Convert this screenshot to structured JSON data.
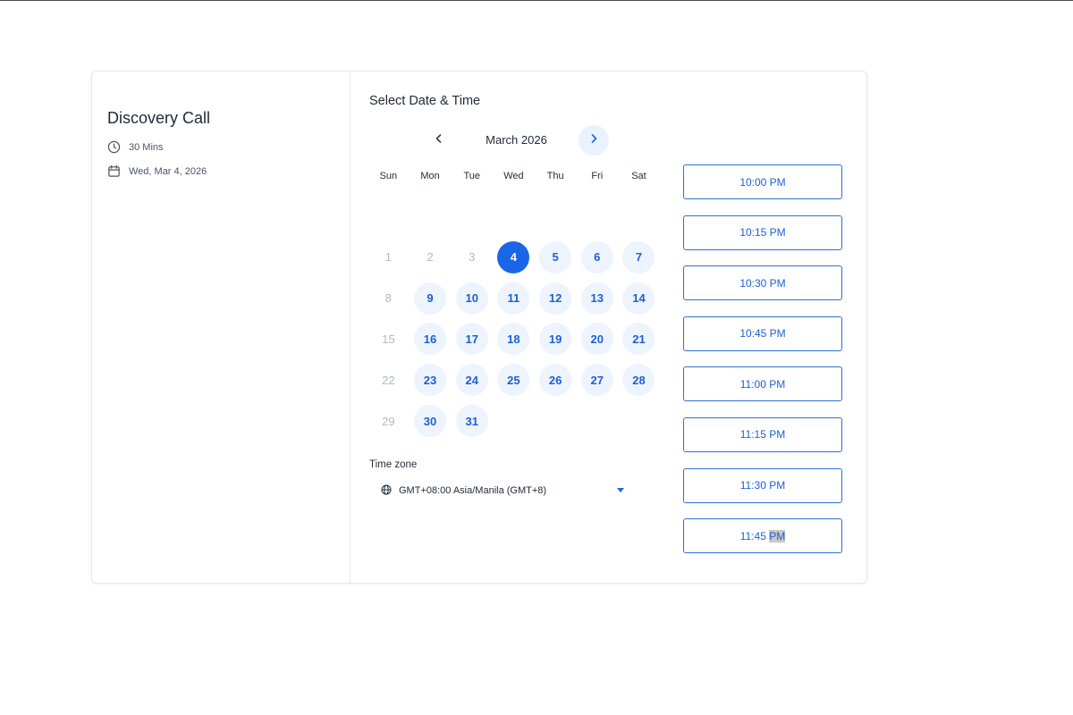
{
  "event": {
    "title": "Discovery Call",
    "duration": "30 Mins",
    "date": "Wed, Mar 4, 2026"
  },
  "picker": {
    "title": "Select Date & Time",
    "month": "March 2026",
    "weekdays": [
      "Sun",
      "Mon",
      "Tue",
      "Wed",
      "Thu",
      "Fri",
      "Sat"
    ],
    "first_weekday_offset": 0,
    "days": [
      {
        "d": "1",
        "state": "disabled"
      },
      {
        "d": "2",
        "state": "disabled"
      },
      {
        "d": "3",
        "state": "disabled"
      },
      {
        "d": "4",
        "state": "selected"
      },
      {
        "d": "5",
        "state": "available"
      },
      {
        "d": "6",
        "state": "available"
      },
      {
        "d": "7",
        "state": "available"
      },
      {
        "d": "8",
        "state": "disabled"
      },
      {
        "d": "9",
        "state": "available"
      },
      {
        "d": "10",
        "state": "available"
      },
      {
        "d": "11",
        "state": "available"
      },
      {
        "d": "12",
        "state": "available"
      },
      {
        "d": "13",
        "state": "available"
      },
      {
        "d": "14",
        "state": "available"
      },
      {
        "d": "15",
        "state": "disabled"
      },
      {
        "d": "16",
        "state": "available"
      },
      {
        "d": "17",
        "state": "available"
      },
      {
        "d": "18",
        "state": "available"
      },
      {
        "d": "19",
        "state": "available"
      },
      {
        "d": "20",
        "state": "available"
      },
      {
        "d": "21",
        "state": "available"
      },
      {
        "d": "22",
        "state": "disabled"
      },
      {
        "d": "23",
        "state": "available"
      },
      {
        "d": "24",
        "state": "available"
      },
      {
        "d": "25",
        "state": "available"
      },
      {
        "d": "26",
        "state": "available"
      },
      {
        "d": "27",
        "state": "available"
      },
      {
        "d": "28",
        "state": "available"
      },
      {
        "d": "29",
        "state": "disabled"
      },
      {
        "d": "30",
        "state": "available"
      },
      {
        "d": "31",
        "state": "available"
      }
    ]
  },
  "timezone": {
    "label": "Time zone",
    "value": "GMT+08:00 Asia/Manila (GMT+8)"
  },
  "slots": [
    {
      "time": "10:00 PM"
    },
    {
      "time": "10:15 PM"
    },
    {
      "time": "10:30 PM"
    },
    {
      "time": "10:45 PM"
    },
    {
      "time": "11:00 PM"
    },
    {
      "time": "11:15 PM"
    },
    {
      "time": "11:30 PM"
    },
    {
      "time_main": "11:45",
      "time_suffix": "PM"
    }
  ],
  "icons": {
    "duration": "clock-icon",
    "date": "calendar-icon",
    "prev": "chevron-left-icon",
    "next": "chevron-right-icon",
    "timezone": "globe-icon",
    "dropdown": "caret-down-icon"
  },
  "colors": {
    "accent": "#1a66e8",
    "day_bg": "#eef4fe",
    "slot_border": "#2f6fd9"
  }
}
